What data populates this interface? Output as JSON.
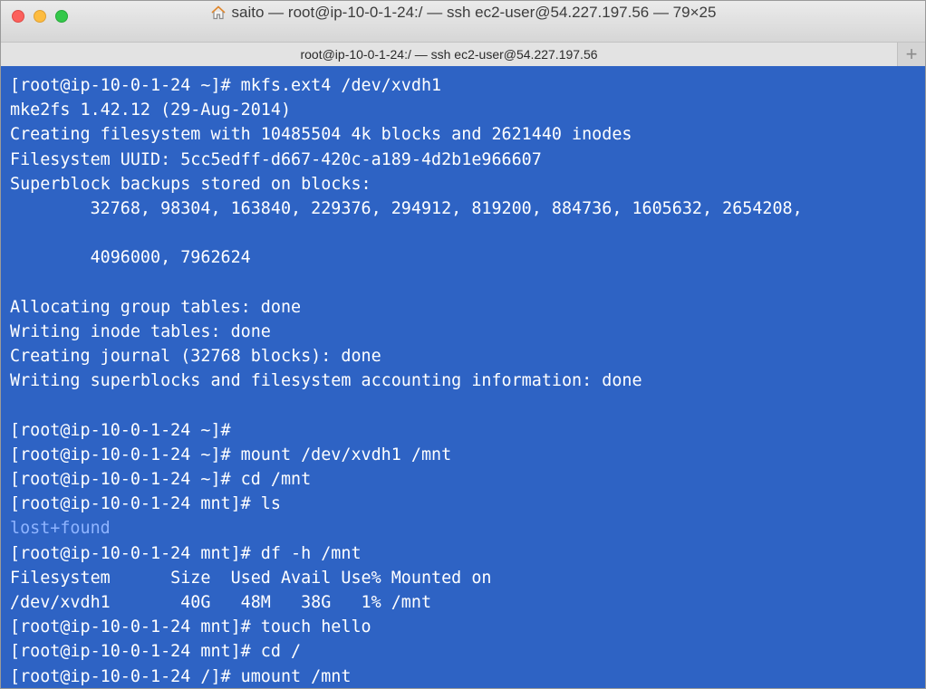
{
  "window": {
    "title": "saito — root@ip-10-0-1-24:/ — ssh ec2-user@54.227.197.56 — 79×25",
    "icon": "home-icon"
  },
  "tabs": [
    {
      "label": "root@ip-10-0-1-24:/ — ssh ec2-user@54.227.197.56"
    }
  ],
  "new_tab_label": "+",
  "colors": {
    "terminal_bg": "#2e63c4",
    "terminal_fg": "#ffffff",
    "directory_fg": "#8fb4ff"
  },
  "terminal": {
    "lines": [
      {
        "text": "[root@ip-10-0-1-24 ~]# mkfs.ext4 /dev/xvdh1",
        "kind": "prompt"
      },
      {
        "text": "mke2fs 1.42.12 (29-Aug-2014)",
        "kind": "output"
      },
      {
        "text": "Creating filesystem with 10485504 4k blocks and 2621440 inodes",
        "kind": "output"
      },
      {
        "text": "Filesystem UUID: 5cc5edff-d667-420c-a189-4d2b1e966607",
        "kind": "output"
      },
      {
        "text": "Superblock backups stored on blocks:",
        "kind": "output"
      },
      {
        "text": "        32768, 98304, 163840, 229376, 294912, 819200, 884736, 1605632, 2654208,",
        "kind": "output"
      },
      {
        "text": "",
        "kind": "output"
      },
      {
        "text": "        4096000, 7962624",
        "kind": "output"
      },
      {
        "text": "",
        "kind": "output"
      },
      {
        "text": "Allocating group tables: done",
        "kind": "output"
      },
      {
        "text": "Writing inode tables: done",
        "kind": "output"
      },
      {
        "text": "Creating journal (32768 blocks): done",
        "kind": "output"
      },
      {
        "text": "Writing superblocks and filesystem accounting information: done",
        "kind": "output"
      },
      {
        "text": "",
        "kind": "output"
      },
      {
        "text": "[root@ip-10-0-1-24 ~]#",
        "kind": "prompt"
      },
      {
        "text": "[root@ip-10-0-1-24 ~]# mount /dev/xvdh1 /mnt",
        "kind": "prompt"
      },
      {
        "text": "[root@ip-10-0-1-24 ~]# cd /mnt",
        "kind": "prompt"
      },
      {
        "text": "[root@ip-10-0-1-24 mnt]# ls",
        "kind": "prompt"
      },
      {
        "text": "lost+found",
        "kind": "dir"
      },
      {
        "text": "[root@ip-10-0-1-24 mnt]# df -h /mnt",
        "kind": "prompt"
      },
      {
        "text": "Filesystem      Size  Used Avail Use% Mounted on",
        "kind": "output"
      },
      {
        "text": "/dev/xvdh1       40G   48M   38G   1% /mnt",
        "kind": "output"
      },
      {
        "text": "[root@ip-10-0-1-24 mnt]# touch hello",
        "kind": "prompt"
      },
      {
        "text": "[root@ip-10-0-1-24 mnt]# cd /",
        "kind": "prompt"
      },
      {
        "text": "[root@ip-10-0-1-24 /]# umount /mnt",
        "kind": "prompt"
      }
    ]
  }
}
